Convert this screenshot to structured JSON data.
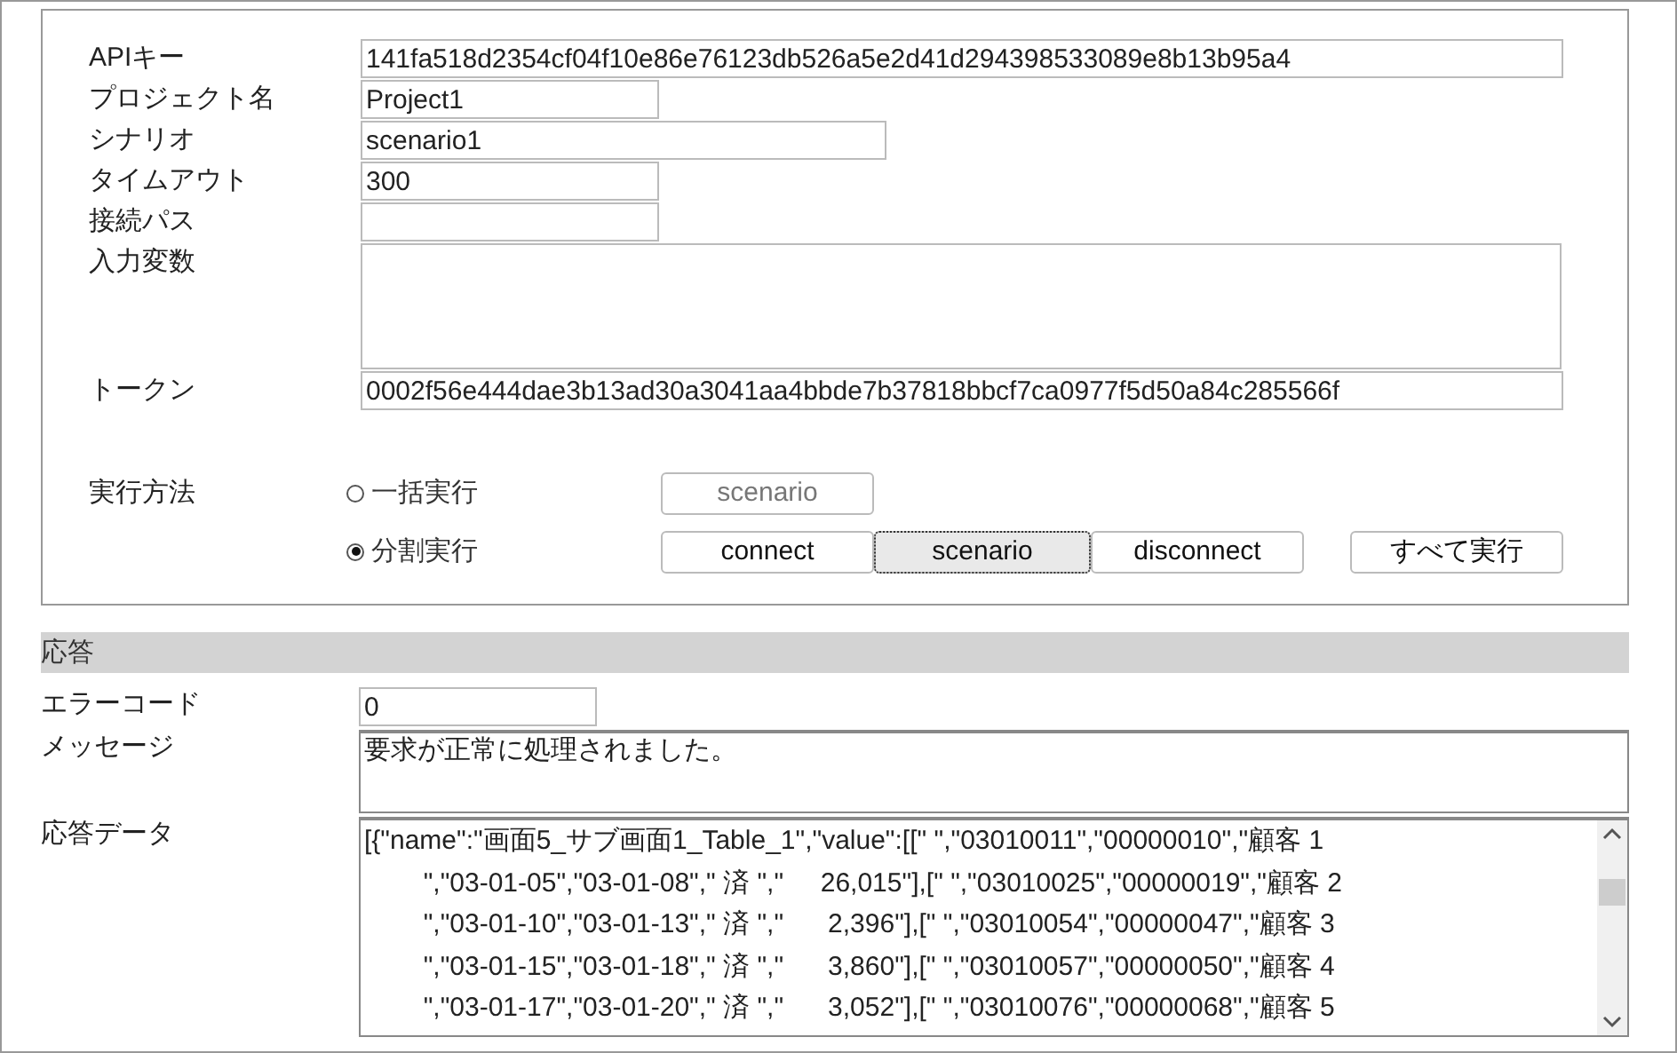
{
  "config": {
    "fields": [
      {
        "kind": "long",
        "label": "APIキー",
        "value": "141fa518d2354cf04f10e86e76123db526a5e2d41d294398533089e8b13b95a4"
      },
      {
        "kind": "short",
        "label": "プロジェクト名",
        "value": "Project1"
      },
      {
        "kind": "medium",
        "label": "シナリオ",
        "value": "scenario1"
      },
      {
        "kind": "short",
        "label": "タイムアウト",
        "value": "300"
      },
      {
        "kind": "short",
        "label": "接続パス"
      },
      {
        "kind": "multiline",
        "label": "入力変数"
      },
      {
        "kind": "long",
        "label": "トークン",
        "value": "0002f56e444dae3b13ad30a3041aa4bbde7b37818bbcf7ca0977f5d50a84c285566f"
      }
    ],
    "execution": {
      "label": "実行方法",
      "modes": [
        {
          "label": "一括実行",
          "selected": false,
          "buttons": [
            {
              "label": "scenario",
              "disabled": true,
              "pressed": false
            }
          ]
        },
        {
          "label": "分割実行",
          "selected": true,
          "buttons": [
            {
              "label": "connect",
              "disabled": false,
              "pressed": false
            },
            {
              "label": "scenario",
              "disabled": false,
              "pressed": true
            },
            {
              "label": "disconnect",
              "disabled": false,
              "pressed": false
            }
          ]
        }
      ],
      "run_all_button": "すべて実行"
    }
  },
  "response": {
    "header": "応答",
    "error_code": {
      "label": "エラーコード",
      "value": "0"
    },
    "message": {
      "label": "メッセージ",
      "value": "要求が正常に処理されました。"
    },
    "data": {
      "label": "応答データ",
      "lines": [
        "[{\"name\":\"画面5_サブ画面1_Table_1\",\"value\":[[\" \",\"03010011\",\"00000010\",\"顧客 1",
        "        \",\"03-01-05\",\"03-01-08\",\" 済 \",\"     26,015\"],[\" \",\"03010025\",\"00000019\",\"顧客 2",
        "        \",\"03-01-10\",\"03-01-13\",\" 済 \",\"      2,396\"],[\" \",\"03010054\",\"00000047\",\"顧客 3",
        "        \",\"03-01-15\",\"03-01-18\",\" 済 \",\"      3,860\"],[\" \",\"03010057\",\"00000050\",\"顧客 4",
        "        \",\"03-01-17\",\"03-01-20\",\" 済 \",\"      3,052\"],[\" \",\"03010076\",\"00000068\",\"顧客 5"
      ]
    }
  }
}
